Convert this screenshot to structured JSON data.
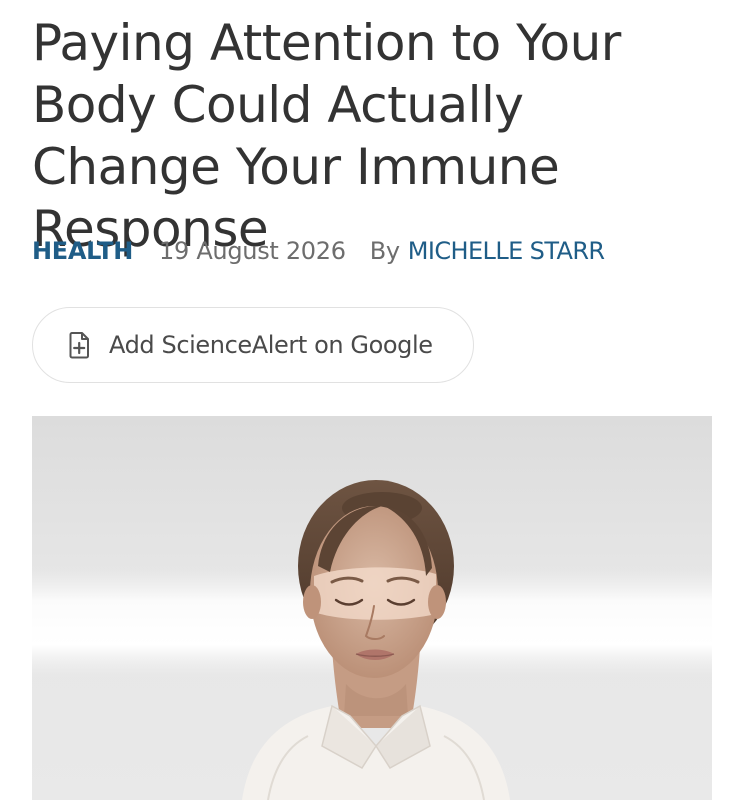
{
  "article": {
    "title": "Paying Attention to Your Body Could Actually Change Your Immune Response",
    "category": "HEALTH",
    "date": "19 August 2026",
    "by_label": "By",
    "author": "MICHELLE STARR"
  },
  "google_button": {
    "label": "Add ScienceAlert on Google",
    "icon": "add-document-icon"
  },
  "hero_image": {
    "icon": "woman-eyes-closed-photo"
  },
  "colors": {
    "link_blue": "#1f5d87",
    "title_text": "#333333",
    "meta_gray": "#6d6d6d",
    "button_border": "#e1e1e1"
  }
}
